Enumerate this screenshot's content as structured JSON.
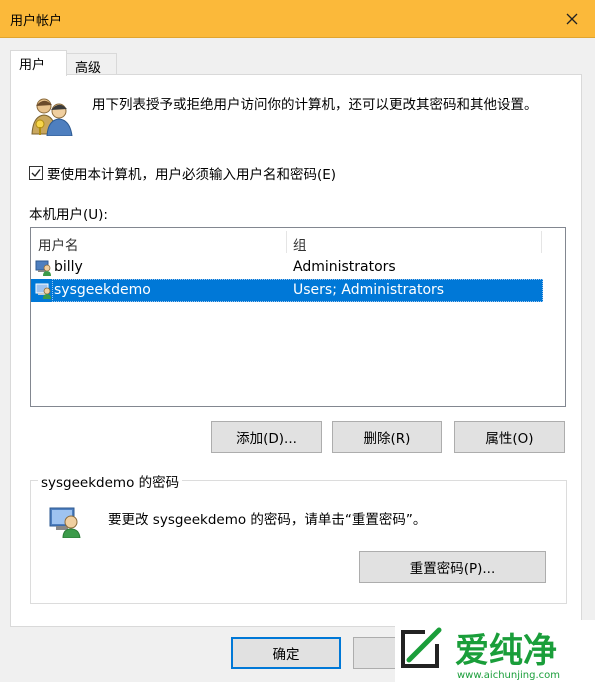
{
  "window": {
    "title": "用户帐户",
    "close_icon": "close-icon"
  },
  "tabs": [
    {
      "label": "用户",
      "active": true
    },
    {
      "label": "高级",
      "active": false
    }
  ],
  "intro": {
    "icon": "users-icon",
    "text": "用下列表授予或拒绝用户访问你的计算机，还可以更改其密码和其他设置。"
  },
  "require_login": {
    "label": "要使用本计算机，用户必须输入用户名和密码(E)",
    "checked": true
  },
  "local_users": {
    "label": "本机用户(U):",
    "columns": [
      "用户名",
      "组"
    ],
    "rows": [
      {
        "name": "billy",
        "group": "Administrators",
        "selected": false
      },
      {
        "name": "sysgeekdemo",
        "group": "Users; Administrators",
        "selected": true
      }
    ]
  },
  "actions": {
    "add": "添加(D)...",
    "remove": "删除(R)",
    "properties": "属性(O)"
  },
  "password_group": {
    "title": "sysgeekdemo 的密码",
    "text": "要更改 sysgeekdemo 的密码，请单击“重置密码”。",
    "reset_button": "重置密码(P)..."
  },
  "footer": {
    "ok": "确定",
    "cancel": ""
  },
  "watermark": {
    "brand": "爱纯净",
    "url": "www.aichunjing.com",
    "accent": "#1a9e3a"
  },
  "colors": {
    "titlebar": "#fbb93a",
    "selection": "#0078d7"
  }
}
